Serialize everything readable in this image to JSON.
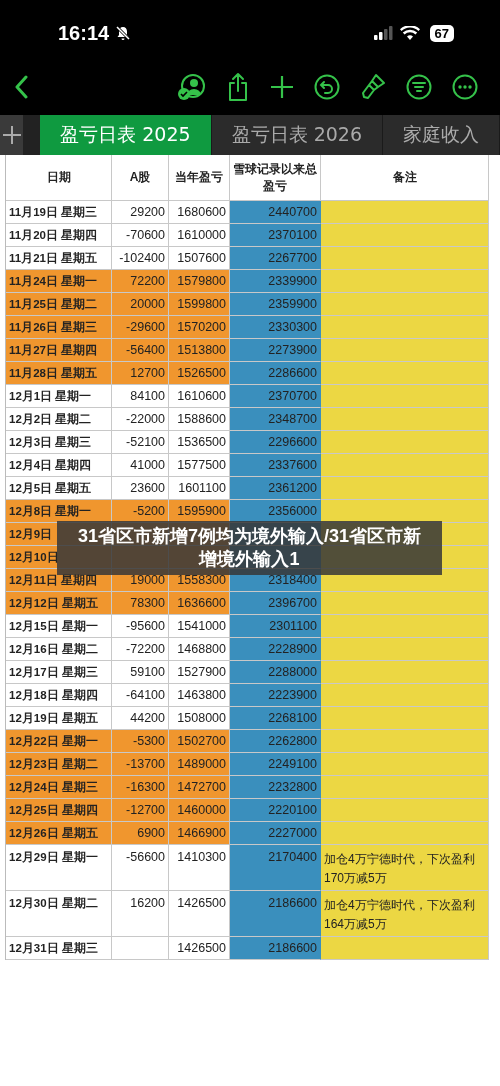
{
  "status_bar": {
    "time": "16:14",
    "battery": "67"
  },
  "tabs": [
    {
      "label": "盈亏日表 2025",
      "selected": true
    },
    {
      "label": "盈亏日表 2026",
      "selected": false
    },
    {
      "label": "家庭收入",
      "selected": false
    }
  ],
  "table": {
    "columns": [
      "日期",
      "A股",
      "当年盈亏",
      "雪球记录以来总盈亏",
      "备注"
    ],
    "rows": [
      {
        "date": "11月19日 星期三",
        "a_shares": "29200",
        "year_pnl": "1680600",
        "total_pnl": "2440700",
        "highlighted": false
      },
      {
        "date": "11月20日 星期四",
        "a_shares": "-70600",
        "year_pnl": "1610000",
        "total_pnl": "2370100",
        "highlighted": false
      },
      {
        "date": "11月21日 星期五",
        "a_shares": "-102400",
        "year_pnl": "1507600",
        "total_pnl": "2267700",
        "highlighted": false
      },
      {
        "date": "11月24日 星期一",
        "a_shares": "72200",
        "year_pnl": "1579800",
        "total_pnl": "2339900",
        "highlighted": true
      },
      {
        "date": "11月25日 星期二",
        "a_shares": "20000",
        "year_pnl": "1599800",
        "total_pnl": "2359900",
        "highlighted": true
      },
      {
        "date": "11月26日 星期三",
        "a_shares": "-29600",
        "year_pnl": "1570200",
        "total_pnl": "2330300",
        "highlighted": true
      },
      {
        "date": "11月27日 星期四",
        "a_shares": "-56400",
        "year_pnl": "1513800",
        "total_pnl": "2273900",
        "highlighted": true
      },
      {
        "date": "11月28日 星期五",
        "a_shares": "12700",
        "year_pnl": "1526500",
        "total_pnl": "2286600",
        "highlighted": true
      },
      {
        "date": "12月1日 星期一",
        "a_shares": "84100",
        "year_pnl": "1610600",
        "total_pnl": "2370700",
        "highlighted": false
      },
      {
        "date": "12月2日 星期二",
        "a_shares": "-22000",
        "year_pnl": "1588600",
        "total_pnl": "2348700",
        "highlighted": false
      },
      {
        "date": "12月3日 星期三",
        "a_shares": "-52100",
        "year_pnl": "1536500",
        "total_pnl": "2296600",
        "highlighted": false
      },
      {
        "date": "12月4日 星期四",
        "a_shares": "41000",
        "year_pnl": "1577500",
        "total_pnl": "2337600",
        "highlighted": false
      },
      {
        "date": "12月5日 星期五",
        "a_shares": "23600",
        "year_pnl": "1601100",
        "total_pnl": "2361200",
        "highlighted": false
      },
      {
        "date": "12月8日 星期一",
        "a_shares": "-5200",
        "year_pnl": "1595900",
        "total_pnl": "2356000",
        "highlighted": true
      },
      {
        "date": "12月9日",
        "highlighted": true
      },
      {
        "date": "12月10日",
        "highlighted": true
      },
      {
        "date": "12月11日 星期四",
        "a_shares": "19000",
        "year_pnl": "1558300",
        "total_pnl": "2318400",
        "highlighted": true
      },
      {
        "date": "12月12日 星期五",
        "a_shares": "78300",
        "year_pnl": "1636600",
        "total_pnl": "2396700",
        "highlighted": true
      },
      {
        "date": "12月15日 星期一",
        "a_shares": "-95600",
        "year_pnl": "1541000",
        "total_pnl": "2301100",
        "highlighted": false
      },
      {
        "date": "12月16日 星期二",
        "a_shares": "-72200",
        "year_pnl": "1468800",
        "total_pnl": "2228900",
        "highlighted": false
      },
      {
        "date": "12月17日 星期三",
        "a_shares": "59100",
        "year_pnl": "1527900",
        "total_pnl": "2288000",
        "highlighted": false
      },
      {
        "date": "12月18日 星期四",
        "a_shares": "-64100",
        "year_pnl": "1463800",
        "total_pnl": "2223900",
        "highlighted": false
      },
      {
        "date": "12月19日 星期五",
        "a_shares": "44200",
        "year_pnl": "1508000",
        "total_pnl": "2268100",
        "highlighted": false
      },
      {
        "date": "12月22日 星期一",
        "a_shares": "-5300",
        "year_pnl": "1502700",
        "total_pnl": "2262800",
        "highlighted": true
      },
      {
        "date": "12月23日 星期二",
        "a_shares": "-13700",
        "year_pnl": "1489000",
        "total_pnl": "2249100",
        "highlighted": true
      },
      {
        "date": "12月24日 星期三",
        "a_shares": "-16300",
        "year_pnl": "1472700",
        "total_pnl": "2232800",
        "highlighted": true
      },
      {
        "date": "12月25日 星期四",
        "a_shares": "-12700",
        "year_pnl": "1460000",
        "total_pnl": "2220100",
        "highlighted": true
      },
      {
        "date": "12月26日 星期五",
        "a_shares": "6900",
        "year_pnl": "1466900",
        "total_pnl": "2227000",
        "highlighted": true
      },
      {
        "date": "12月29日 星期一",
        "a_shares": "-56600",
        "year_pnl": "1410300",
        "total_pnl": "2170400",
        "note": "加仓4万宁德时代，下次盈利170万减5万",
        "highlighted": false
      },
      {
        "date": "12月30日 星期二",
        "a_shares": "16200",
        "year_pnl": "1426500",
        "total_pnl": "2186600",
        "note": "加仓4万宁德时代，下次盈利164万减5万",
        "highlighted": false
      },
      {
        "date": "12月31日 星期三",
        "year_pnl": "1426500",
        "total_pnl": "2186600",
        "highlighted": false
      }
    ]
  },
  "overlay_caption": "31省区市新增7例均为境外输入/31省区市新增境外输入1"
}
